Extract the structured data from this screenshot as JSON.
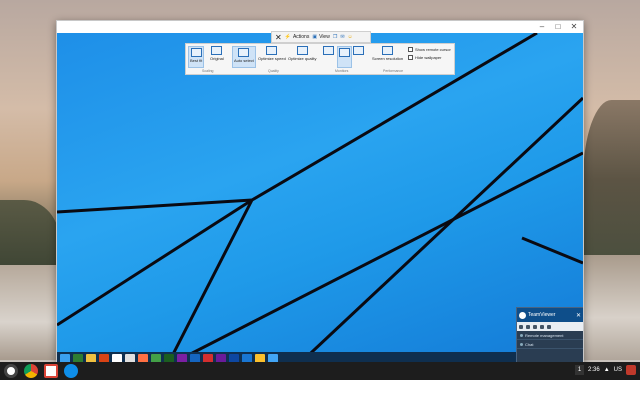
{
  "toolbar": {
    "actions_label": "Actions",
    "view_label": "View",
    "buttons": [
      {
        "label": "Best fit"
      },
      {
        "label": "Original"
      },
      {
        "label": "Auto select"
      },
      {
        "label": "Optimize speed"
      },
      {
        "label": "Optimize quality"
      },
      {
        "label": "Screen resolution"
      }
    ],
    "groups": {
      "scaling": "Scaling",
      "quality": "Quality",
      "monitors": "Monitors",
      "performance": "Performance"
    },
    "checkboxes": [
      {
        "label": "Show remote cursor"
      },
      {
        "label": "Hide wallpaper"
      }
    ]
  },
  "teamviewer_panel": {
    "title": "TeamViewer",
    "rows": [
      {
        "label": "Remote management"
      },
      {
        "label": "Chat"
      }
    ]
  },
  "status": {
    "notification_count": "1",
    "time": "2:36",
    "network": "US"
  },
  "colors": {
    "desktop_blue": "#1e8fe8",
    "taskbar": "#0f2f4f",
    "teamviewer_blue": "#0e4e8a"
  },
  "icons": [
    "close-icon",
    "actions-icon",
    "view-icon",
    "chat-icon",
    "smiley-icon",
    "chrome-icon",
    "gmail-icon",
    "teamviewer-icon",
    "launcher-icon"
  ]
}
